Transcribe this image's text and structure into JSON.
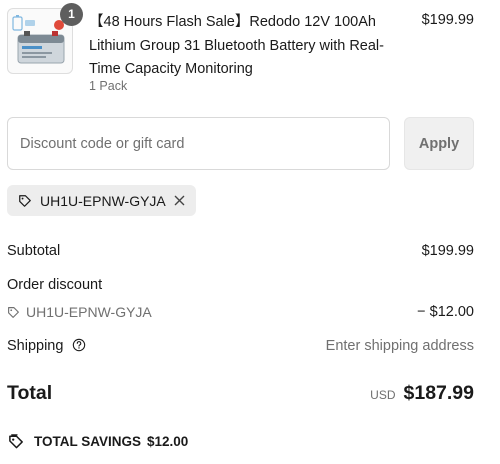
{
  "product": {
    "title": "【48 Hours Flash Sale】Redodo 12V 100Ah Lithium Group 31 Bluetooth Battery with Real-Time Capacity Monitoring",
    "variant": "1 Pack",
    "price": "$199.99",
    "quantity": "1"
  },
  "discount": {
    "placeholder": "Discount code or gift card",
    "value": "",
    "apply_label": "Apply",
    "applied_code": "UH1U-EPNW-GYJA"
  },
  "summary": {
    "subtotal_label": "Subtotal",
    "subtotal_value": "$199.99",
    "order_discount_label": "Order discount",
    "discount_code": "UH1U-EPNW-GYJA",
    "discount_value": "− $12.00",
    "shipping_label": "Shipping",
    "shipping_value": "Enter shipping address",
    "total_label": "Total",
    "currency": "USD",
    "total_value": "$187.99",
    "savings_label": "TOTAL SAVINGS",
    "savings_value": "$12.00"
  },
  "colors": {
    "text": "#1a1a1a",
    "muted": "#707070",
    "chip_background": "#ededed",
    "button_background": "#f0f0f0",
    "badge": "#5e5e5e"
  },
  "icons": {
    "discount_tag": "tag-icon",
    "remove_code": "close-icon",
    "shipping_help": "question-circle-icon",
    "savings": "savings-tag-icon"
  }
}
